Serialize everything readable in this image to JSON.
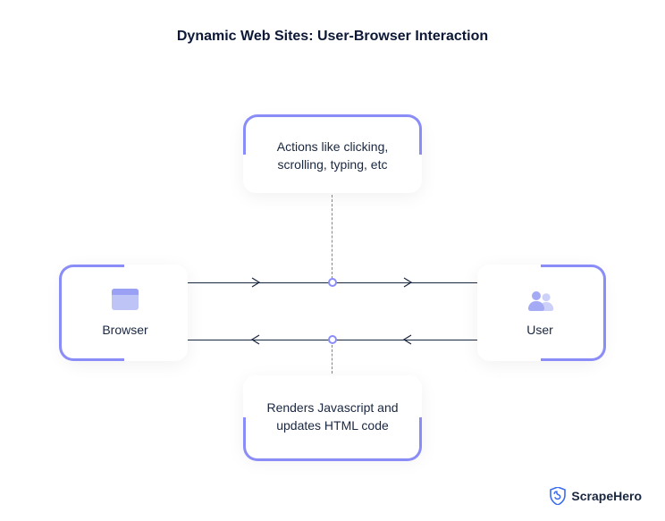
{
  "title": "Dynamic Web Sites: User-Browser Interaction",
  "nodes": {
    "browser": {
      "label": "Browser"
    },
    "user": {
      "label": "User"
    },
    "top": {
      "text": "Actions like clicking, scrolling, typing, etc"
    },
    "bottom": {
      "text": "Renders Javascript and updates HTML code"
    }
  },
  "brand": "ScrapeHero"
}
